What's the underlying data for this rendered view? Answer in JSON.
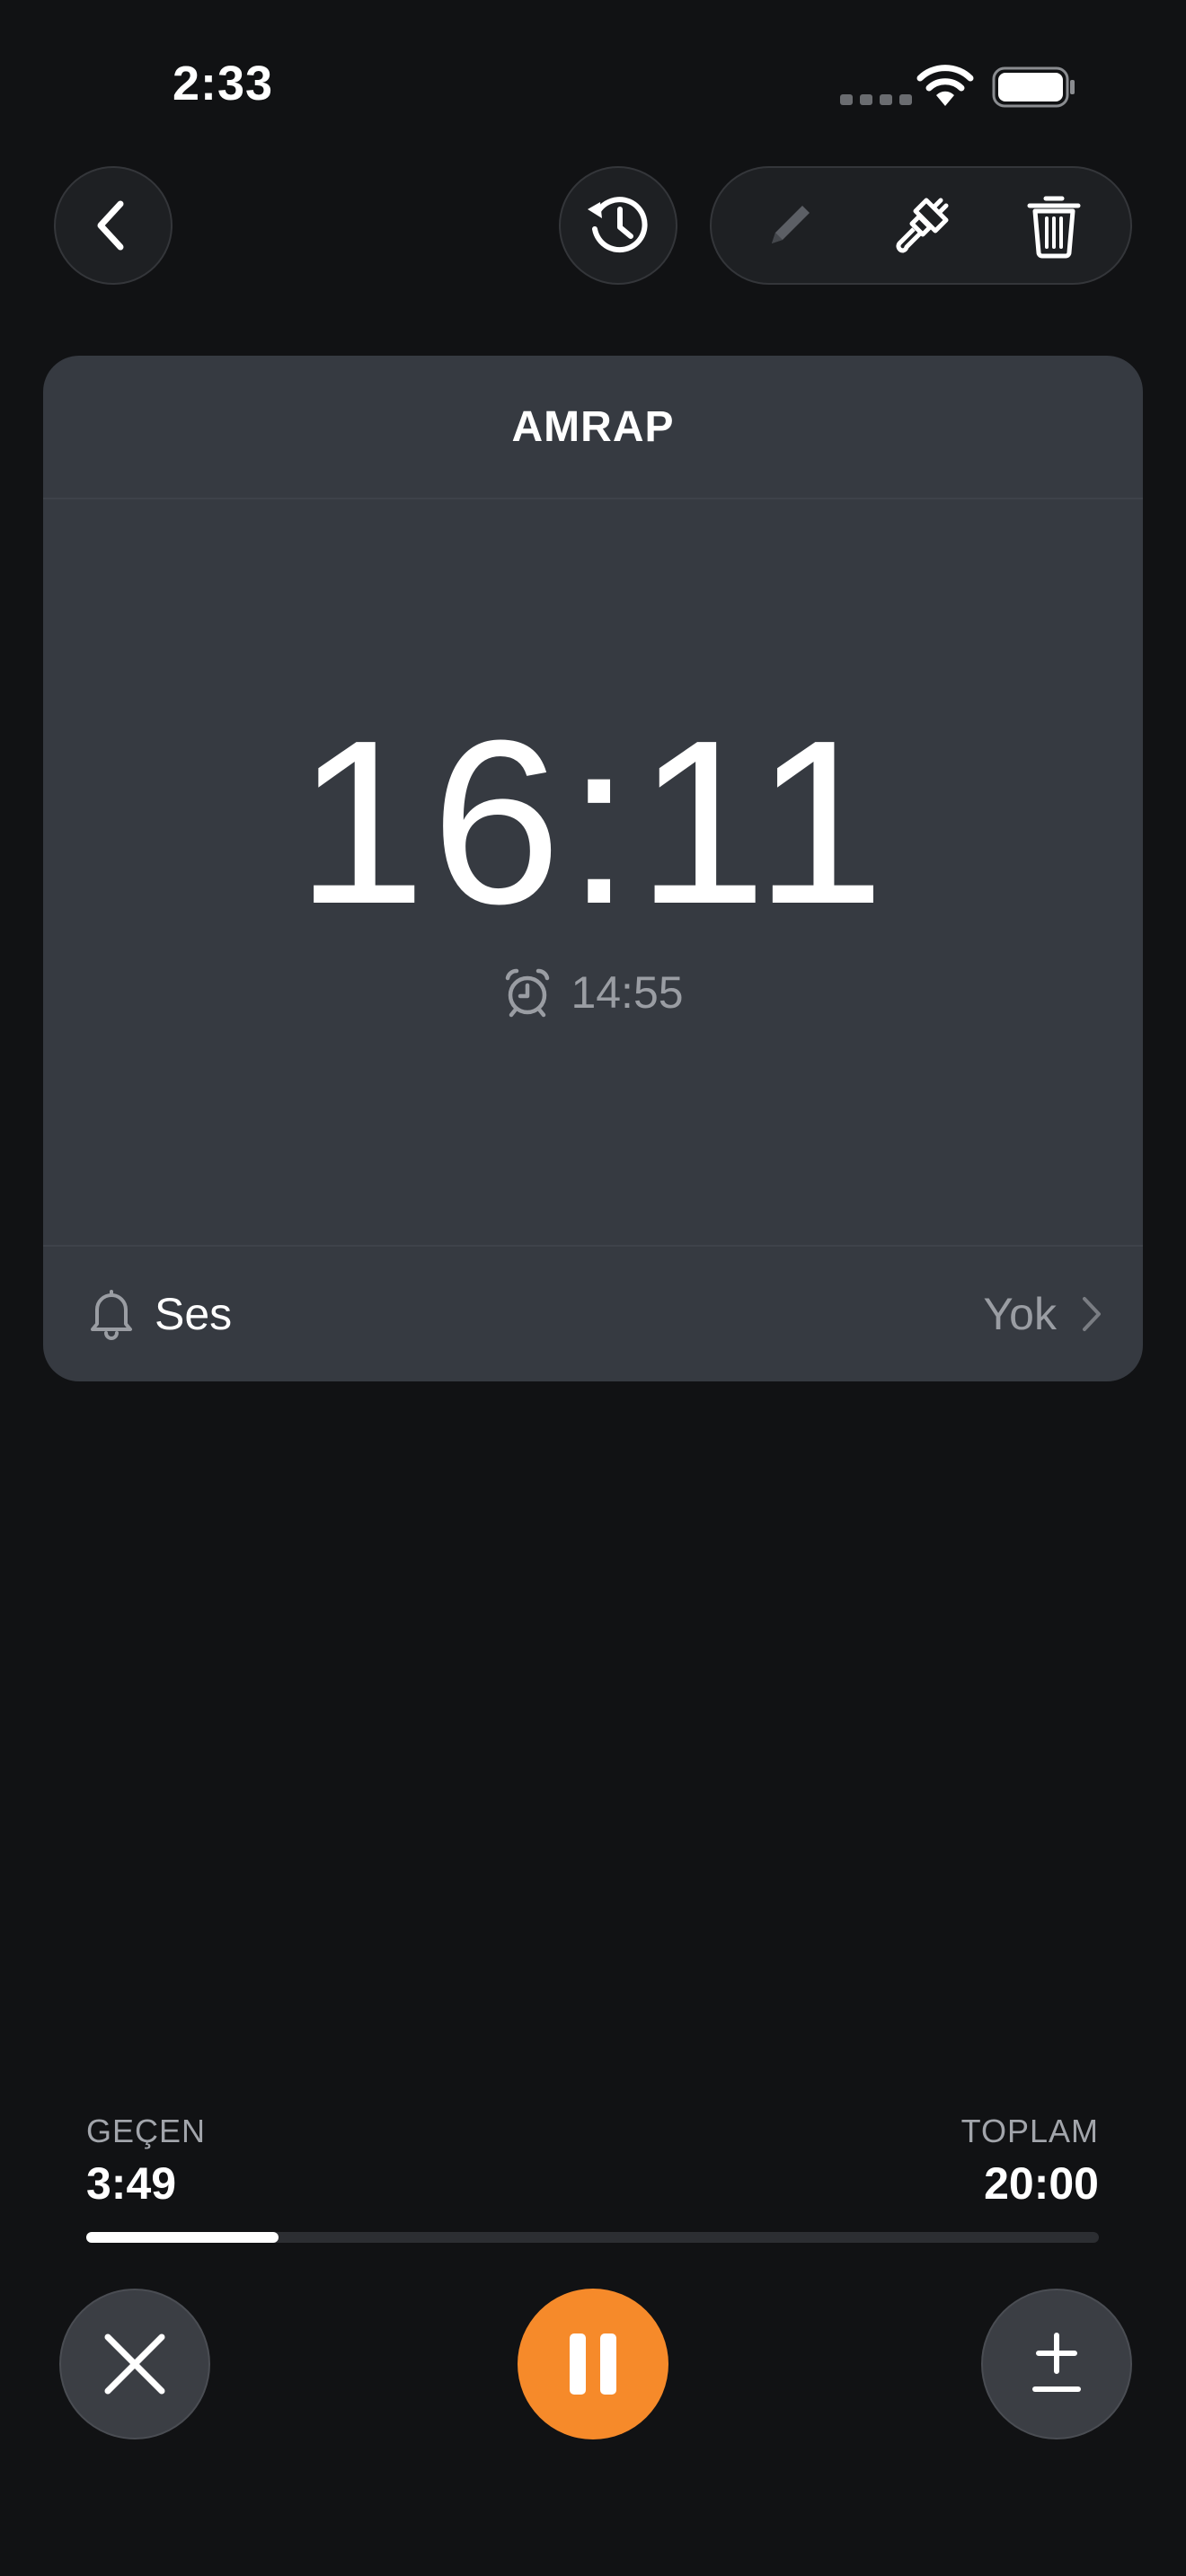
{
  "status_bar": {
    "time": "2:33"
  },
  "header": {
    "back": "chevron-left-icon",
    "history": "history-icon",
    "tools": [
      "pencil-icon",
      "paintbrush-icon",
      "trash-icon"
    ]
  },
  "card": {
    "title": "AMRAP",
    "remaining": "16:11",
    "alarm_time": "14:55",
    "sound_label": "Ses",
    "sound_value": "Yok"
  },
  "progress": {
    "elapsed_label": "GEÇEN",
    "elapsed_value": "3:49",
    "total_label": "TOPLAM",
    "total_value": "20:00",
    "fraction": 0.19
  },
  "controls": {
    "cancel": "close-icon",
    "pause": "pause-icon",
    "adjust": "plus-minus-icon"
  },
  "colors": {
    "background": "#111214",
    "card": "#363a41",
    "accent": "#f68a2a",
    "muted_text": "#9a9da3"
  }
}
